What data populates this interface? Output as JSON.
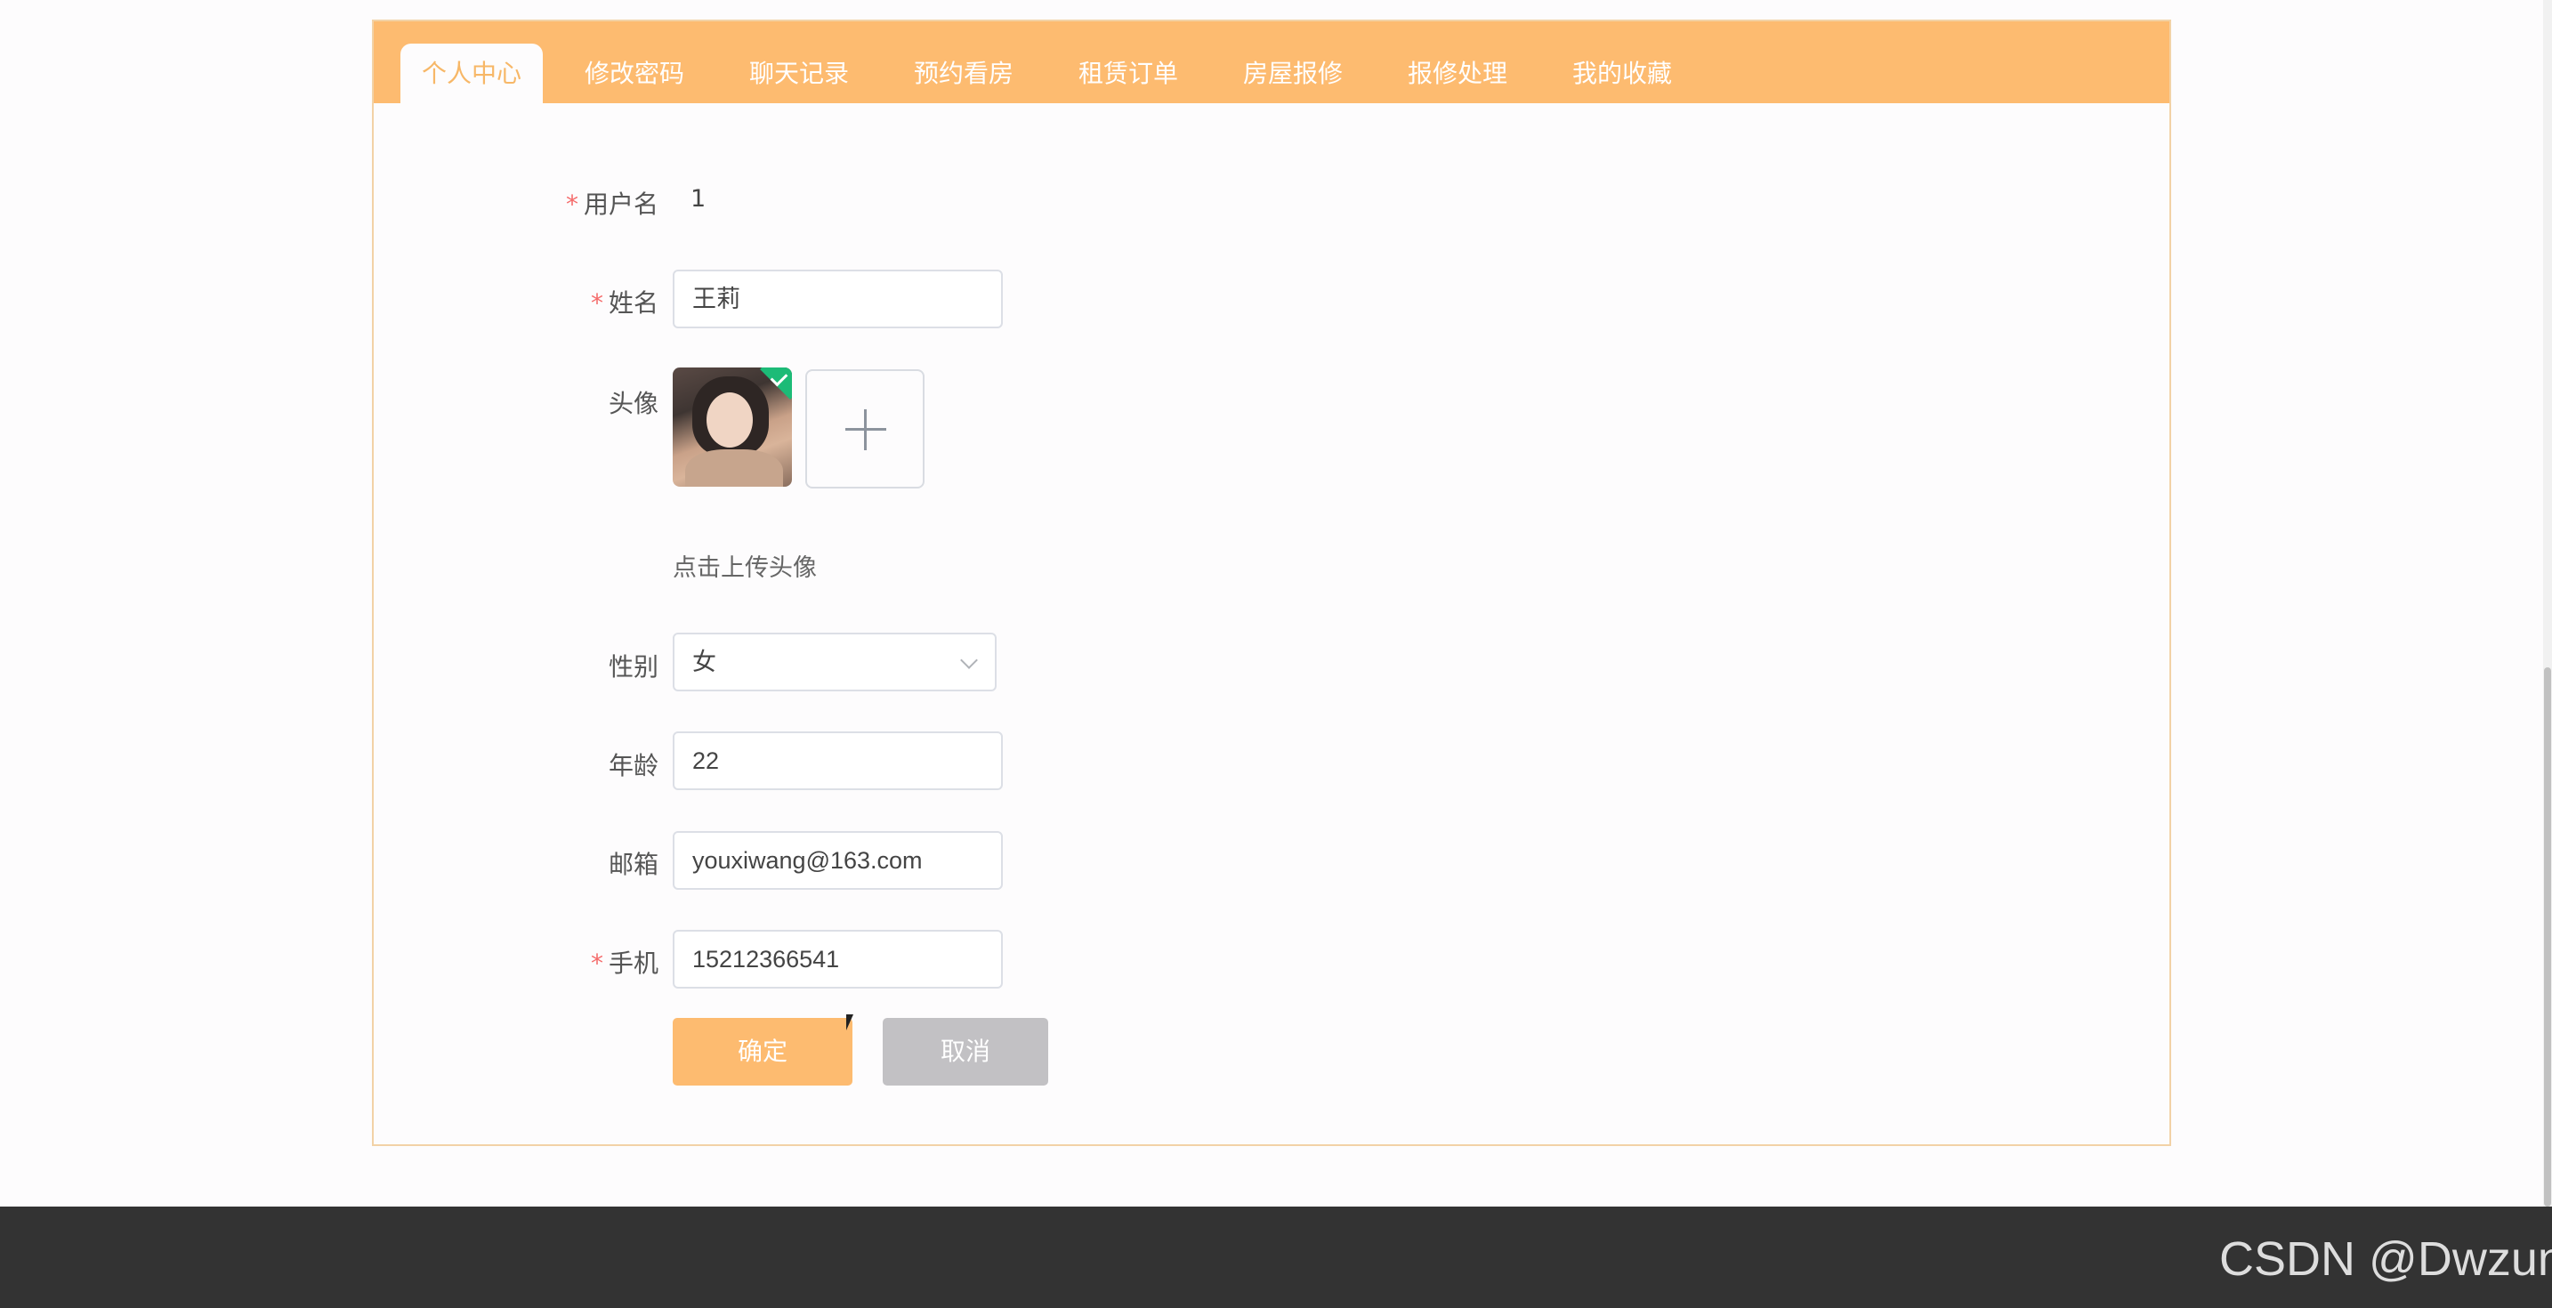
{
  "tabs": [
    {
      "label": "个人中心",
      "active": true
    },
    {
      "label": "修改密码"
    },
    {
      "label": "聊天记录"
    },
    {
      "label": "预约看房"
    },
    {
      "label": "租赁订单"
    },
    {
      "label": "房屋报修"
    },
    {
      "label": "报修处理"
    },
    {
      "label": "我的收藏"
    }
  ],
  "form": {
    "username": {
      "label": "用户名",
      "value": "1",
      "required": true
    },
    "name": {
      "label": "姓名",
      "value": "王莉",
      "required": true
    },
    "avatar": {
      "label": "头像",
      "hint": "点击上传头像"
    },
    "gender": {
      "label": "性别",
      "value": "女"
    },
    "age": {
      "label": "年龄",
      "value": "22"
    },
    "email": {
      "label": "邮箱",
      "value": "youxiwang@163.com"
    },
    "phone": {
      "label": "手机",
      "value": "15212366541",
      "required": true
    }
  },
  "buttons": {
    "confirm": "确定",
    "cancel": "取消"
  },
  "required_mark": "*",
  "watermark": "CSDN @Dwzun",
  "colors": {
    "accent": "#fdbb70",
    "active_tab_text": "#f7b767",
    "confirm_button": "#fdbb70",
    "cancel_button": "#c2c1c4",
    "required": "#f56c6c",
    "footer": "#333333"
  }
}
